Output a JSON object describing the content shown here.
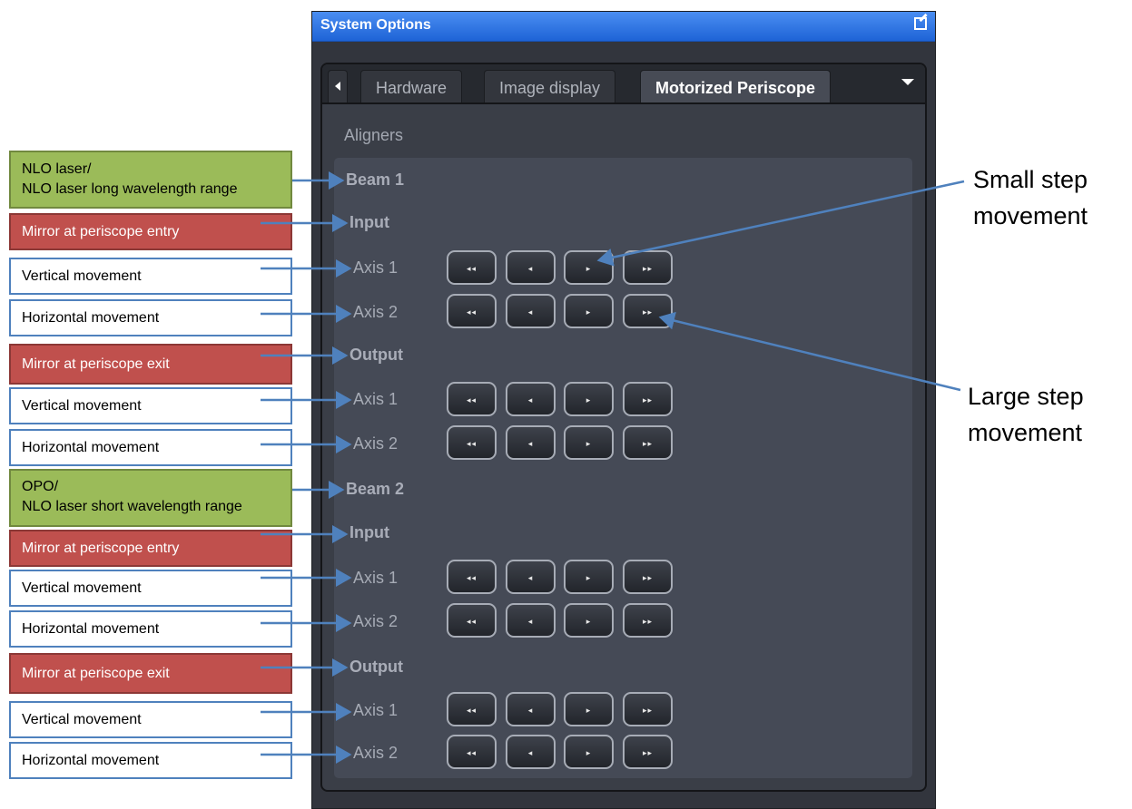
{
  "window": {
    "title": "System Options",
    "undock_icon": "undock-icon"
  },
  "tabs": [
    {
      "label": "Hardware",
      "active": false
    },
    {
      "label": "Image display",
      "active": false
    },
    {
      "label": "Motorized Periscope",
      "active": true
    }
  ],
  "section": {
    "title": "Aligners"
  },
  "beams": [
    {
      "label": "Beam 1",
      "input": {
        "label": "Input",
        "axis1": "Axis 1",
        "axis2": "Axis 2"
      },
      "output": {
        "label": "Output",
        "axis1": "Axis 1",
        "axis2": "Axis 2"
      }
    },
    {
      "label": "Beam 2",
      "input": {
        "label": "Input",
        "axis1": "Axis 1",
        "axis2": "Axis 2"
      },
      "output": {
        "label": "Output",
        "axis1": "Axis 1",
        "axis2": "Axis 2"
      }
    }
  ],
  "step_buttons": {
    "large_back": "◂◂",
    "small_back": "◂",
    "small_forward": "▸",
    "large_forward": "▸▸"
  },
  "annotations": {
    "beam1_title": "NLO laser/",
    "beam1_subtitle": "NLO laser long wavelength range",
    "beam2_title": "OPO/",
    "beam2_subtitle": "NLO laser short wavelength range",
    "mirror_entry": "Mirror at periscope entry",
    "mirror_exit": "Mirror at periscope exit",
    "vertical": "Vertical movement",
    "horizontal": "Horizontal movement",
    "small_step_line1": "Small step",
    "small_step_line2": "movement",
    "large_step_line1": "Large step",
    "large_step_line2": "movement"
  },
  "colors": {
    "title_bar": "#2a6fe0",
    "panel_bg": "#32353d",
    "annotation_green": "#9bbb59",
    "annotation_red": "#c0504d",
    "annotation_border_blue": "#4f81bd",
    "arrow": "#4f81bd"
  }
}
